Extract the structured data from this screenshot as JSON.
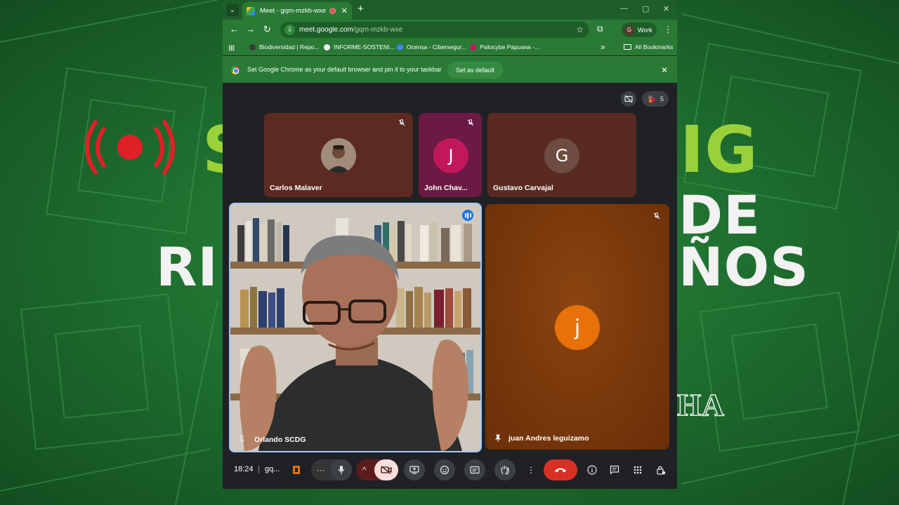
{
  "background_slide": {
    "words": [
      "S",
      "IG",
      "DE",
      "RI",
      "ÑOS",
      "HA"
    ]
  },
  "browser": {
    "tab": {
      "title": "Meet - gqm-mzkb-wxe",
      "close": "✕"
    },
    "window_controls": [
      "—",
      "▢",
      "✕"
    ],
    "url": {
      "host": "meet.google.com",
      "path": "/gqm-mzkb-wxe"
    },
    "profile_initial": "G",
    "profile_label": "Work",
    "bookmarks": [
      {
        "label": "Biodiversidad | Repo...",
        "color": "#3a3a3a"
      },
      {
        "label": "INFORME-SOSTENI...",
        "color": "#f1f3f4"
      },
      {
        "label": "Ocensa - Cibersegur...",
        "color": "#4285f4"
      },
      {
        "label": "Psilocybe Papuana -...",
        "color": "#c2185b"
      }
    ],
    "all_bookmarks": "All Bookmarks",
    "infobar": {
      "text": "Set Google Chrome as your default browser and pin it to your taskbar",
      "button": "Set as default"
    }
  },
  "meet": {
    "participant_count": "5",
    "participants": [
      {
        "name": "Carlos Malaver",
        "tile_color": "#5c2a21",
        "muted": true,
        "avatar": "photo"
      },
      {
        "name": "John Chav...",
        "initial": "J",
        "tile_color": "#6b1a44",
        "avatar_color": "#c2185b",
        "muted": true
      },
      {
        "name": "Gustavo Carvajal",
        "initial": "G",
        "tile_color": "#5a2a22",
        "avatar_color": "#6d4c41",
        "muted": false
      },
      {
        "name": "Orlando SCDG",
        "speaking": true,
        "video": true
      },
      {
        "name": "juan Andres leguizamo",
        "initial": "j",
        "tile_color": "#7a3a0e",
        "avatar_color": "#e8710a",
        "muted": true,
        "pinned": true
      }
    ],
    "controls": {
      "time": "18:24",
      "separator": "|",
      "meeting_code": "gq...",
      "more_dots": "···",
      "chevron": "^",
      "more_options": "⋮"
    },
    "colors": {
      "hang_up": "#d93025",
      "camera_off": "#f9dedc",
      "speaking_border": "#a8c7fa"
    }
  }
}
